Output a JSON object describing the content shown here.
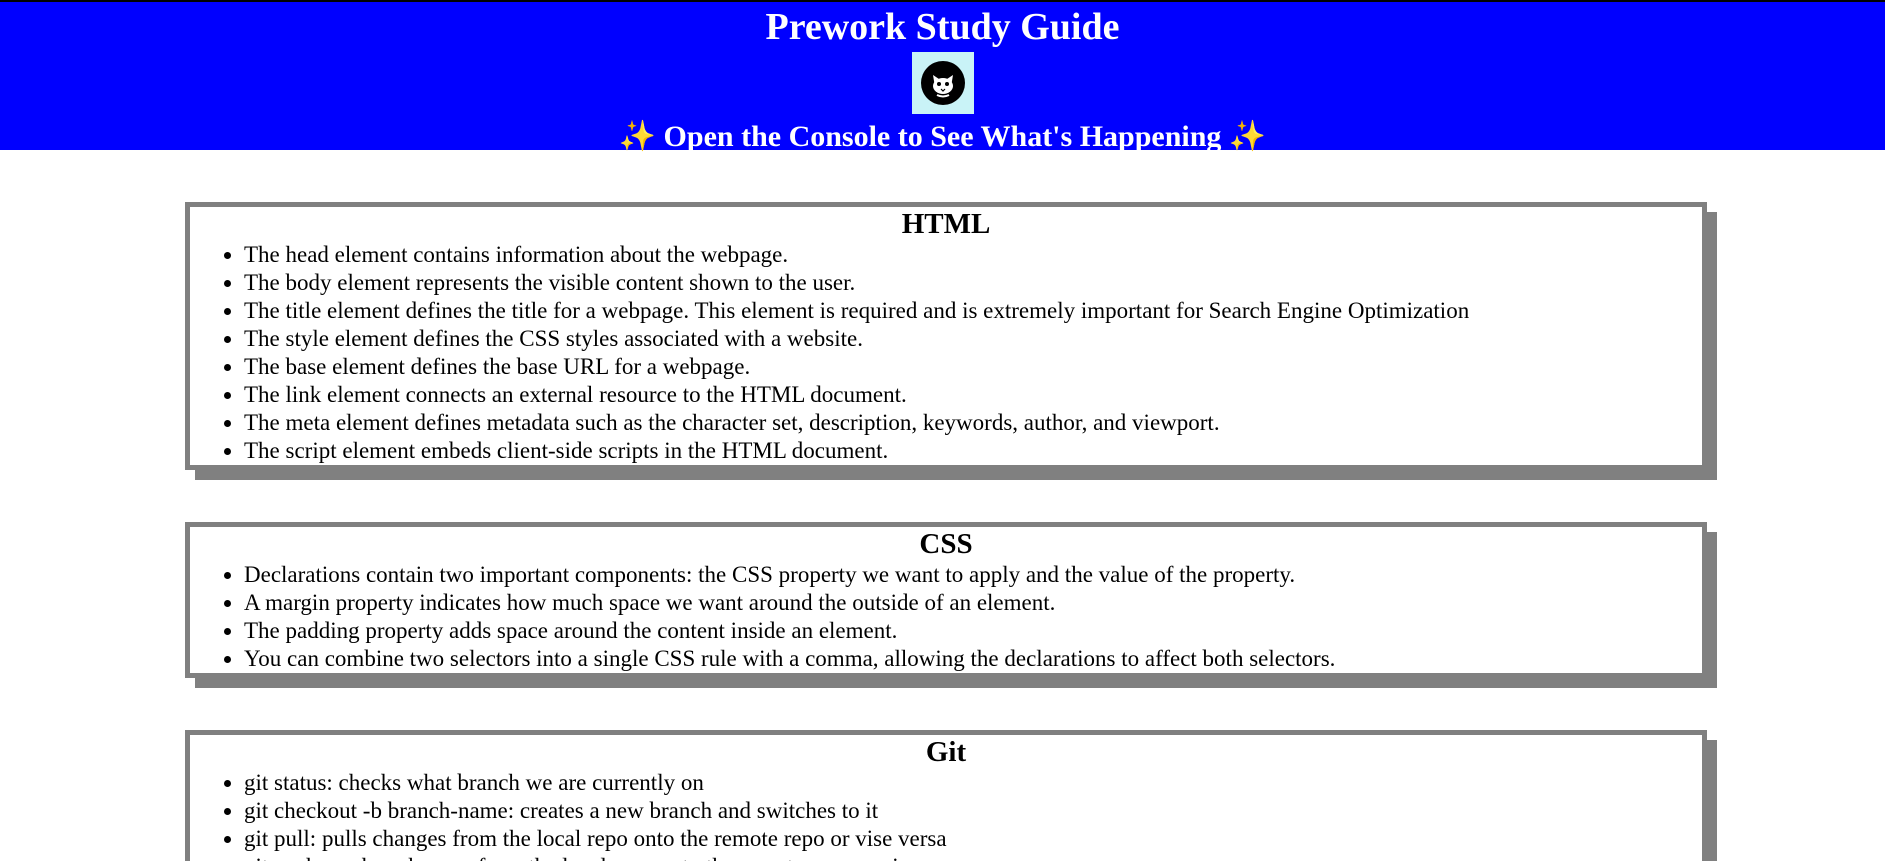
{
  "header": {
    "title": "Prework Study Guide",
    "subtitle": "✨ Open the Console to See What's Happening ✨",
    "colors": {
      "background": "#0000ff",
      "text": "#ffffff",
      "logo_bg": "#c9f3f7"
    },
    "logo_icon": "cat-logo-icon"
  },
  "sections": [
    {
      "title": "HTML",
      "items": [
        "The head element contains information about the webpage.",
        "The body element represents the visible content shown to the user.",
        "The title element defines the title for a webpage. This element is required and is extremely important for Search Engine Optimization",
        "The style element defines the CSS styles associated with a website.",
        "The base element defines the base URL for a webpage.",
        "The link element connects an external resource to the HTML document.",
        "The meta element defines metadata such as the character set, description, keywords, author, and viewport.",
        "The script element embeds client-side scripts in the HTML document."
      ]
    },
    {
      "title": "CSS",
      "items": [
        "Declarations contain two important components: the CSS property we want to apply and the value of the property.",
        "A margin property indicates how much space we want around the outside of an element.",
        "The padding property adds space around the content inside an element.",
        "You can combine two selectors into a single CSS rule with a comma, allowing the declarations to affect both selectors."
      ]
    },
    {
      "title": "Git",
      "items": [
        "git status: checks what branch we are currently on",
        "git checkout -b branch-name: creates a new branch and switches to it",
        "git pull: pulls changes from the local repo onto the remote repo or vise versa",
        "git push: pushes changes from the local repo onto the remote repo or vise versa"
      ]
    }
  ],
  "card_border_color": "#808080"
}
